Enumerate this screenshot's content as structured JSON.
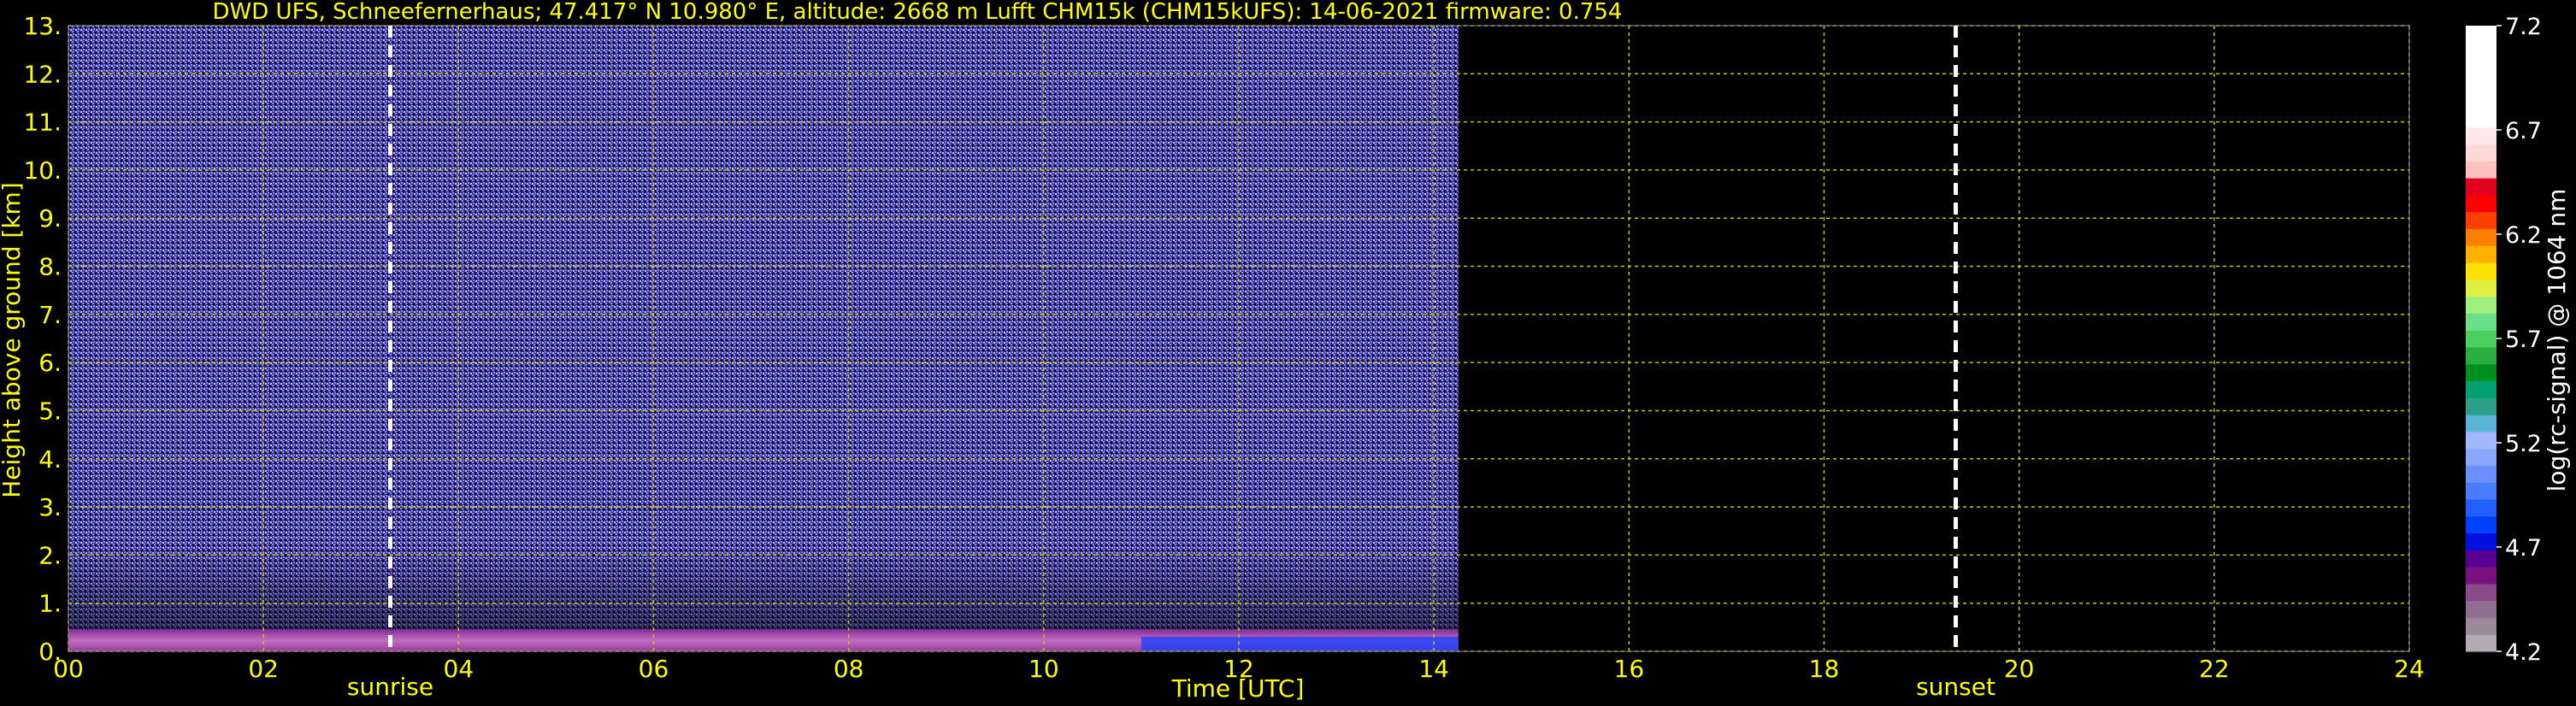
{
  "chart_data": {
    "type": "heatmap",
    "title": "DWD UFS, Schneefernerhaus; 47.417° N 10.980° E, altitude: 2668 m    Lufft CHM15k (CHM15kUFS): 14-06-2021    firmware: 0.754",
    "xlabel": "Time [UTC]",
    "ylabel": "Height above ground [km]",
    "xlim": [
      0,
      24
    ],
    "ylim": [
      0,
      13
    ],
    "x_ticks": [
      "00",
      "02",
      "04",
      "06",
      "08",
      "10",
      "12",
      "14",
      "16",
      "18",
      "20",
      "22",
      "24"
    ],
    "y_ticks": [
      "0.",
      "1.",
      "2.",
      "3.",
      "4.",
      "5.",
      "6.",
      "7.",
      "8.",
      "9.",
      "10.",
      "11.",
      "12.",
      "13."
    ],
    "data_end_hour": 14.25,
    "grid": true,
    "vertical_lines": [
      {
        "label": "sunrise",
        "hour": 3.3
      },
      {
        "label": "sunset",
        "hour": 19.35
      }
    ],
    "colorbar": {
      "label": "log(rc-signal) @ 1064 nm",
      "ticks": [
        "4.2",
        "4.7",
        "5.2",
        "5.7",
        "6.2",
        "6.7",
        "7.2"
      ],
      "range": [
        4.2,
        7.2
      ],
      "colors": [
        "#b3aab3",
        "#9a8a9a",
        "#8f6e8f",
        "#8a4a8a",
        "#7a1080",
        "#5a0090",
        "#0010e0",
        "#0040ff",
        "#2060ff",
        "#4a7cff",
        "#6a90ff",
        "#8aa6ff",
        "#a0b8ff",
        "#5ab4d8",
        "#2aa08a",
        "#00a070",
        "#009020",
        "#2ab040",
        "#4ad060",
        "#6ae08a",
        "#a0f080",
        "#e0f040",
        "#ffe000",
        "#ffb000",
        "#ff8000",
        "#ff4000",
        "#ff0000",
        "#e00020",
        "#ffc0c0",
        "#ffd8d8",
        "#ffe8e8",
        "#ffffff",
        "#ffffff",
        "#ffffff",
        "#ffffff",
        "#ffffff",
        "#ffffff"
      ]
    }
  },
  "colors": {
    "axis_text": "#ffff00",
    "grid": "#c8c800",
    "background": "#000000",
    "marker": "#ffffff"
  }
}
